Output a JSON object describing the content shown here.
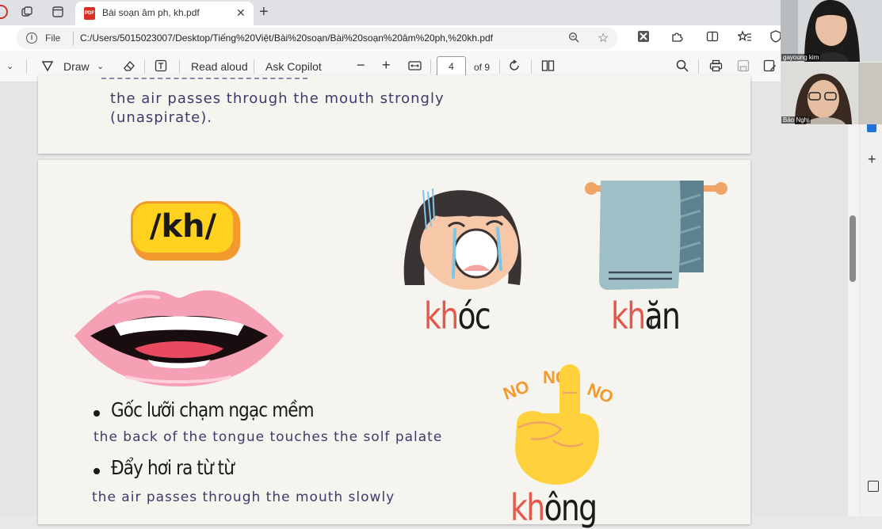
{
  "tab": {
    "title": "Bài soạn âm ph, kh.pdf",
    "favicon_text": "PDF"
  },
  "address": {
    "scheme_label": "File",
    "url": "C:/Users/5015023007/Desktop/Tiếng%20Việt/Bài%20soạn/Bài%20soạn%20âm%20ph,%20kh.pdf"
  },
  "pdf_toolbar": {
    "draw": "Draw",
    "read_aloud": "Read aloud",
    "ask_copilot": "Ask Copilot",
    "page_number": "4",
    "page_total": "of 9"
  },
  "prev_page": {
    "line1": "the air passes through the mouth strongly",
    "line2": "(unaspirate)."
  },
  "lesson": {
    "sound_badge": "/kh/",
    "words": [
      {
        "highlight": "kh",
        "rest": "óc"
      },
      {
        "highlight": "kh",
        "rest": "ăn"
      },
      {
        "highlight": "kh",
        "rest": "ông"
      }
    ],
    "no_signs": [
      "NO",
      "NO",
      "NO"
    ],
    "bullets": [
      {
        "vi": "Gốc lưỡi chạm ngạc mềm",
        "en": "the back of the tongue touches the solf palate"
      },
      {
        "vi": "Đẩy hơi ra từ từ",
        "en": "the air passes through the mouth slowly"
      }
    ]
  },
  "participants": [
    {
      "name": "gayoung kim"
    },
    {
      "name": "Bảo Nghi"
    }
  ],
  "colors": {
    "accent_red": "#e4574a",
    "badge_yellow": "#ffd21f",
    "badge_shadow": "#f29a2e",
    "hand_text": "#3b3c6b"
  }
}
